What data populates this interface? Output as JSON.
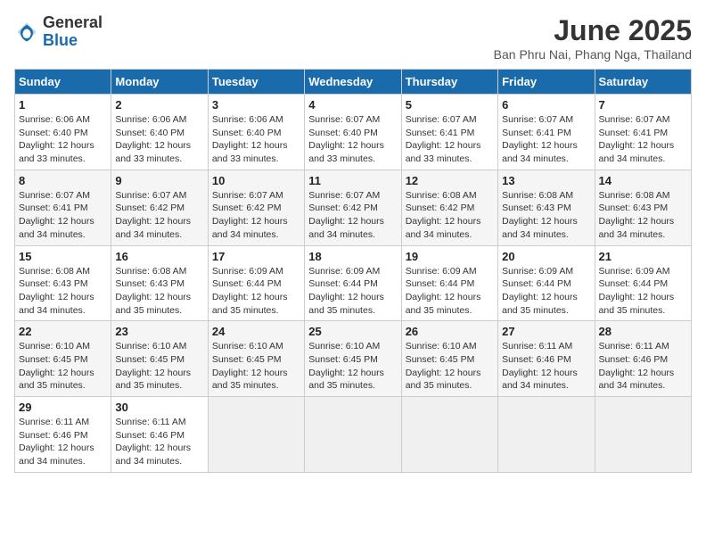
{
  "header": {
    "logo_general": "General",
    "logo_blue": "Blue",
    "month_year": "June 2025",
    "location": "Ban Phru Nai, Phang Nga, Thailand"
  },
  "weekdays": [
    "Sunday",
    "Monday",
    "Tuesday",
    "Wednesday",
    "Thursday",
    "Friday",
    "Saturday"
  ],
  "weeks": [
    [
      {
        "day": "1",
        "sunrise": "6:06 AM",
        "sunset": "6:40 PM",
        "daylight": "12 hours and 33 minutes."
      },
      {
        "day": "2",
        "sunrise": "6:06 AM",
        "sunset": "6:40 PM",
        "daylight": "12 hours and 33 minutes."
      },
      {
        "day": "3",
        "sunrise": "6:06 AM",
        "sunset": "6:40 PM",
        "daylight": "12 hours and 33 minutes."
      },
      {
        "day": "4",
        "sunrise": "6:07 AM",
        "sunset": "6:40 PM",
        "daylight": "12 hours and 33 minutes."
      },
      {
        "day": "5",
        "sunrise": "6:07 AM",
        "sunset": "6:41 PM",
        "daylight": "12 hours and 33 minutes."
      },
      {
        "day": "6",
        "sunrise": "6:07 AM",
        "sunset": "6:41 PM",
        "daylight": "12 hours and 34 minutes."
      },
      {
        "day": "7",
        "sunrise": "6:07 AM",
        "sunset": "6:41 PM",
        "daylight": "12 hours and 34 minutes."
      }
    ],
    [
      {
        "day": "8",
        "sunrise": "6:07 AM",
        "sunset": "6:41 PM",
        "daylight": "12 hours and 34 minutes."
      },
      {
        "day": "9",
        "sunrise": "6:07 AM",
        "sunset": "6:42 PM",
        "daylight": "12 hours and 34 minutes."
      },
      {
        "day": "10",
        "sunrise": "6:07 AM",
        "sunset": "6:42 PM",
        "daylight": "12 hours and 34 minutes."
      },
      {
        "day": "11",
        "sunrise": "6:07 AM",
        "sunset": "6:42 PM",
        "daylight": "12 hours and 34 minutes."
      },
      {
        "day": "12",
        "sunrise": "6:08 AM",
        "sunset": "6:42 PM",
        "daylight": "12 hours and 34 minutes."
      },
      {
        "day": "13",
        "sunrise": "6:08 AM",
        "sunset": "6:43 PM",
        "daylight": "12 hours and 34 minutes."
      },
      {
        "day": "14",
        "sunrise": "6:08 AM",
        "sunset": "6:43 PM",
        "daylight": "12 hours and 34 minutes."
      }
    ],
    [
      {
        "day": "15",
        "sunrise": "6:08 AM",
        "sunset": "6:43 PM",
        "daylight": "12 hours and 34 minutes."
      },
      {
        "day": "16",
        "sunrise": "6:08 AM",
        "sunset": "6:43 PM",
        "daylight": "12 hours and 35 minutes."
      },
      {
        "day": "17",
        "sunrise": "6:09 AM",
        "sunset": "6:44 PM",
        "daylight": "12 hours and 35 minutes."
      },
      {
        "day": "18",
        "sunrise": "6:09 AM",
        "sunset": "6:44 PM",
        "daylight": "12 hours and 35 minutes."
      },
      {
        "day": "19",
        "sunrise": "6:09 AM",
        "sunset": "6:44 PM",
        "daylight": "12 hours and 35 minutes."
      },
      {
        "day": "20",
        "sunrise": "6:09 AM",
        "sunset": "6:44 PM",
        "daylight": "12 hours and 35 minutes."
      },
      {
        "day": "21",
        "sunrise": "6:09 AM",
        "sunset": "6:44 PM",
        "daylight": "12 hours and 35 minutes."
      }
    ],
    [
      {
        "day": "22",
        "sunrise": "6:10 AM",
        "sunset": "6:45 PM",
        "daylight": "12 hours and 35 minutes."
      },
      {
        "day": "23",
        "sunrise": "6:10 AM",
        "sunset": "6:45 PM",
        "daylight": "12 hours and 35 minutes."
      },
      {
        "day": "24",
        "sunrise": "6:10 AM",
        "sunset": "6:45 PM",
        "daylight": "12 hours and 35 minutes."
      },
      {
        "day": "25",
        "sunrise": "6:10 AM",
        "sunset": "6:45 PM",
        "daylight": "12 hours and 35 minutes."
      },
      {
        "day": "26",
        "sunrise": "6:10 AM",
        "sunset": "6:45 PM",
        "daylight": "12 hours and 35 minutes."
      },
      {
        "day": "27",
        "sunrise": "6:11 AM",
        "sunset": "6:46 PM",
        "daylight": "12 hours and 34 minutes."
      },
      {
        "day": "28",
        "sunrise": "6:11 AM",
        "sunset": "6:46 PM",
        "daylight": "12 hours and 34 minutes."
      }
    ],
    [
      {
        "day": "29",
        "sunrise": "6:11 AM",
        "sunset": "6:46 PM",
        "daylight": "12 hours and 34 minutes."
      },
      {
        "day": "30",
        "sunrise": "6:11 AM",
        "sunset": "6:46 PM",
        "daylight": "12 hours and 34 minutes."
      },
      null,
      null,
      null,
      null,
      null
    ]
  ],
  "labels": {
    "sunrise": "Sunrise:",
    "sunset": "Sunset:",
    "daylight": "Daylight:"
  }
}
